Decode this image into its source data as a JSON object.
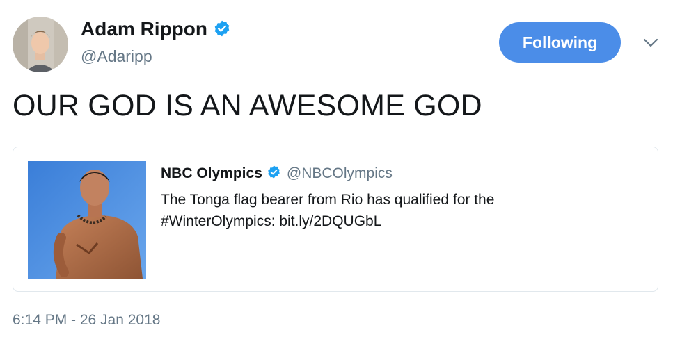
{
  "author": {
    "name": "Adam Rippon",
    "handle": "@Adaripp",
    "verified_icon": "verified-badge-icon",
    "avatar_icon": "user-avatar"
  },
  "follow_button": {
    "label": "Following"
  },
  "menu": {
    "icon": "chevron-down-icon"
  },
  "tweet": {
    "text": "OUR GOD IS AN AWESOME GOD",
    "timestamp": "6:14 PM - 26 Jan 2018"
  },
  "quoted_tweet": {
    "name": "NBC Olympics",
    "handle": "@NBCOlympics",
    "text_line1": "The Tonga flag bearer from Rio has qualified for the",
    "text_line2": "#WinterOlympics: bit.ly/2DQUGbL"
  },
  "colors": {
    "accent": "#4b8de8",
    "verified": "#1da1f2",
    "text_primary": "#14171a",
    "text_secondary": "#657786",
    "border": "#e1e8ed"
  }
}
